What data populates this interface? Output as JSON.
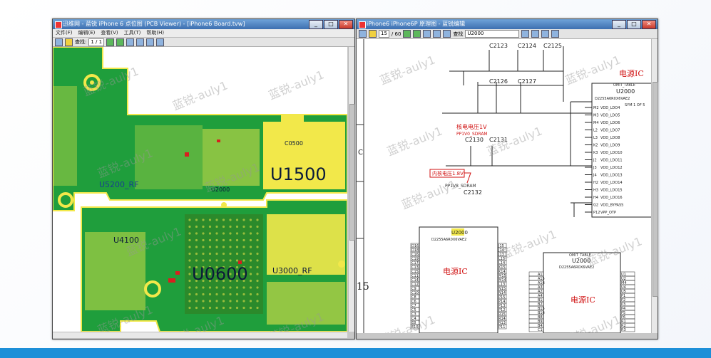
{
  "left_window": {
    "title": "迅维网 - 蓝锐 iPhone 6 点位图 (PCB Viewer) - [iPhone6 Board.tvw]",
    "menu": [
      "文件(F)",
      "编辑(E)",
      "查看(V)",
      "工具(T)",
      "帮助(H)"
    ],
    "toolbar_search_label": "查找:",
    "toolbar_page": "1 / 1",
    "components": {
      "u5200": "U5200_RF",
      "u1500": "U1500",
      "u2000": "U2000",
      "u4100": "U4100",
      "u0600": "U0600",
      "u3000": "U3000_RF",
      "c0500": "C0500"
    },
    "watermark": "蓝锐-auly1"
  },
  "right_window": {
    "title": "iPhone6 iPhone6P 原理图 - 蓝锐编辑",
    "page_current": "15",
    "page_total": "/ 60",
    "search_label": "查找",
    "search_value": "U2000",
    "row_marker": "C",
    "page_number_marker": "15",
    "label_ic": "电源IC",
    "label_vdd": "核电电压1V",
    "label_vdd_net": "PP1V0_SDRAM",
    "label_ic_power": "内核电压1.8V",
    "label_ic_power_net": "PP1V8_SDRAM",
    "cap_labels": [
      "C2123",
      "C2124",
      "C2125",
      "C2126",
      "C2127",
      "C2130",
      "C2131",
      "C2132"
    ],
    "u2000": "U2000",
    "u2000_desc": "D2255A6R0X6VAE2",
    "u2000_table": "OMIT_TABLE",
    "u2000_sym": "SYM 1 OF 5",
    "pins_left_main": [
      "VDD_LDO4",
      "VDD_LDO5",
      "VDD_LDO6",
      "VDD_LDO7",
      "VDD_LDO8",
      "VDD_LDO9",
      "VDD_LDO10",
      "VDD_LDO11",
      "VDD_LDO12",
      "VDD_LDO13",
      "VDD_LDO14",
      "VDD_LDO15",
      "VDD_LDO16",
      "VDD_BYPASS",
      "VPP_OTP"
    ],
    "pins_left_codes": [
      "M2",
      "M3",
      "M4",
      "L2",
      "L3",
      "K2",
      "K3",
      "J2",
      "J3",
      "J4",
      "H2",
      "H3",
      "H4",
      "G2",
      "P12"
    ],
    "sub_ic_left_pins_l": [
      "D16",
      "D18",
      "C16",
      "C19",
      "C17",
      "C13",
      "C15",
      "C11",
      "C14",
      "C12",
      "C9",
      "C10",
      "C8",
      "C6",
      "C7",
      "C5",
      "C3",
      "C4",
      "E8",
      "E10",
      "E12",
      "E14",
      "E13",
      "E16"
    ],
    "sub_ic_left_pins_r": [
      "J15",
      "J14",
      "J13",
      "L15",
      "L14",
      "K15",
      "K14",
      "M15",
      "M14",
      "L13",
      "N15",
      "N14",
      "P15",
      "P14",
      "P13",
      "P12",
      "R15",
      "R14",
      "R13",
      "P11",
      "P10",
      "P9",
      "P8",
      "NC"
    ],
    "sub_ic_right_pins_l": [
      "A1",
      "A15",
      "A16",
      "A3",
      "A2",
      "A4",
      "B1",
      "B2",
      "B15",
      "B16",
      "B8",
      "B9",
      "B4",
      "C1",
      "C2",
      "C13",
      "C14",
      "C15"
    ],
    "sub_ic_right_pins_r": [
      "U1",
      "U2",
      "M4",
      "U4",
      "U5",
      "P1",
      "P2",
      "P3",
      "P4",
      "P5",
      "P6",
      "R1",
      "R2",
      "R3",
      "R4",
      "R5",
      "N1",
      "N2"
    ]
  },
  "colors": {
    "pcb_green": "#1f9e3c",
    "pcb_yellow": "#f2e84a",
    "label_red": "#d01010",
    "chip_blue": "#1a3f8f"
  }
}
